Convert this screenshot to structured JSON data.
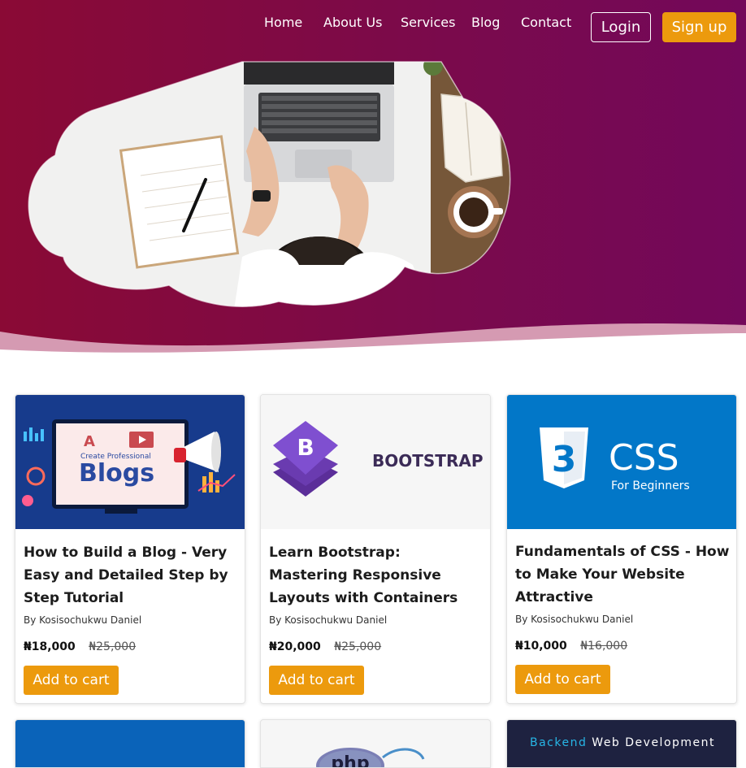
{
  "nav": {
    "links": [
      "Home",
      "About Us",
      "Services",
      "Blog",
      "Contact"
    ],
    "login_label": "Login",
    "signup_label": "Sign up"
  },
  "colors": {
    "hero": "#7d0a45",
    "accent": "#ec9a0d",
    "bootstrap_purple": "#7952b3",
    "css_blue": "#0277c8"
  },
  "products": [
    {
      "title": "How to Build a Blog - Very Easy and Detailed Step by Step Tutorial",
      "author": "By Kosisochukwu Daniel",
      "price": "₦18,000",
      "old_price": "₦25,000",
      "cta": "Add to cart",
      "image": {
        "small": "Create Professional",
        "big": "Blogs",
        "letter": "A"
      }
    },
    {
      "title": "Learn Bootstrap: Mastering Responsive Layouts with Containers",
      "author": "By Kosisochukwu Daniel",
      "price": "₦20,000",
      "old_price": "₦25,000",
      "cta": "Add to cart",
      "image": {
        "logo_letter": "B",
        "wordmark": "BOOTSTRAP"
      }
    },
    {
      "title": "Fundamentals of CSS - How to Make Your Website Attractive",
      "author": "By Kosisochukwu Daniel",
      "price": "₦10,000",
      "old_price": "₦16,000",
      "cta": "Add to cart",
      "image": {
        "badge": "3",
        "big": "CSS",
        "small": "For Beginners"
      }
    }
  ],
  "next_row": {
    "third_title_accent": "Backend",
    "third_title_rest": "Web Development",
    "php_label": "php"
  }
}
